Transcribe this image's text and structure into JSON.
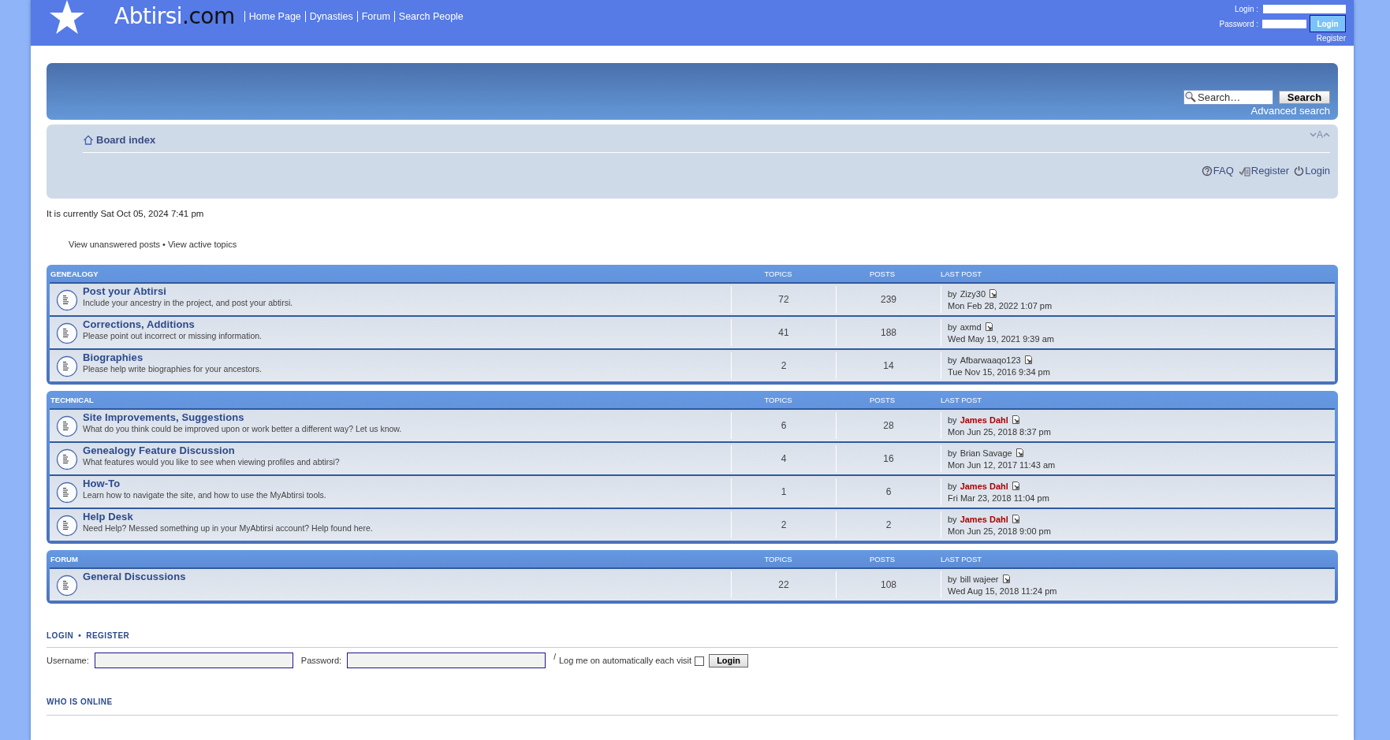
{
  "header": {
    "logo_main": "Abtirsi",
    "logo_suffix": ".com",
    "nav": [
      "Home Page",
      "Dynasties",
      "Forum",
      "Search People"
    ],
    "login_label": "Login :",
    "password_label": "Password :",
    "login_button": "Login",
    "register_link": "Register"
  },
  "headerbar": {
    "search": {
      "placeholder": "Search…"
    },
    "search_button": "Search",
    "advanced_search": "Advanced search"
  },
  "navbar": {
    "breadcrumb": "Board index",
    "font_size_label": "A",
    "links": [
      {
        "kind": "faq",
        "label": "FAQ"
      },
      {
        "kind": "register",
        "label": "Register"
      },
      {
        "kind": "login",
        "label": "Login"
      }
    ]
  },
  "current_time": "It is currently Sat Oct 05, 2024 7:41 pm",
  "quick_links": [
    "View unanswered posts",
    "View active topics"
  ],
  "quick_links_separator": "•",
  "forum_groups": [
    {
      "title": "GENEALOGY",
      "columns": [
        "TOPICS",
        "POSTS",
        "LAST POST"
      ],
      "forums": [
        {
          "name": "Post your Abtirsi",
          "description": "Include your ancestry in the project, and post your abtirsi.",
          "topics": "72",
          "posts": "239",
          "last_post": {
            "by": "by",
            "author": "Zizy30",
            "color": "#333333",
            "date": "Mon Feb 28, 2022 1:07 pm"
          }
        },
        {
          "name": "Corrections, Additions",
          "description": "Please point out incorrect or missing information.",
          "topics": "41",
          "posts": "188",
          "last_post": {
            "by": "by",
            "author": "axmd",
            "color": "#333333",
            "date": "Wed May 19, 2021 9:39 am"
          }
        },
        {
          "name": "Biographies",
          "description": "Please help write biographies for your ancestors.",
          "topics": "2",
          "posts": "14",
          "last_post": {
            "by": "by",
            "author": "Afbarwaaqo123",
            "color": "#333333",
            "date": "Tue Nov 15, 2016 9:34 pm"
          }
        }
      ]
    },
    {
      "title": "TECHNICAL",
      "columns": [
        "TOPICS",
        "POSTS",
        "LAST POST"
      ],
      "forums": [
        {
          "name": "Site Improvements, Suggestions",
          "description": "What do you think could be improved upon or work better a different way? Let us know.",
          "topics": "6",
          "posts": "28",
          "last_post": {
            "by": "by",
            "author": "James Dahl",
            "color": "#aa0000",
            "date": "Mon Jun 25, 2018 8:37 pm"
          }
        },
        {
          "name": "Genealogy Feature Discussion",
          "description": "What features would you like to see when viewing profiles and abtirsi?",
          "topics": "4",
          "posts": "16",
          "last_post": {
            "by": "by",
            "author": "Brian Savage",
            "color": "#333333",
            "date": "Mon Jun 12, 2017 11:43 am"
          }
        },
        {
          "name": "How-To",
          "description": "Learn how to navigate the site, and how to use the MyAbtirsi tools.",
          "topics": "1",
          "posts": "6",
          "last_post": {
            "by": "by",
            "author": "James Dahl",
            "color": "#aa0000",
            "date": "Fri Mar 23, 2018 11:04 pm"
          }
        },
        {
          "name": "Help Desk",
          "description": "Need Help? Messed something up in your MyAbtirsi account? Help found here.",
          "topics": "2",
          "posts": "2",
          "last_post": {
            "by": "by",
            "author": "James Dahl",
            "color": "#aa0000",
            "date": "Mon Jun 25, 2018 9:00 pm"
          }
        }
      ]
    },
    {
      "title": "FORUM",
      "columns": [
        "TOPICS",
        "POSTS",
        "LAST POST"
      ],
      "forums": [
        {
          "name": "General Discussions",
          "topics": "22",
          "posts": "108",
          "last_post": {
            "by": "by",
            "author": "bill wajeer",
            "color": "#333333",
            "date": "Wed Aug 15, 2018 11:24 pm"
          }
        }
      ]
    }
  ],
  "login_section": {
    "links": [
      "LOGIN",
      "REGISTER"
    ],
    "separator": "•",
    "username_label": "Username:",
    "password_label": "Password:",
    "slash": "/",
    "auto_login_label": "Log me on automatically each visit",
    "auto_login": {
      "checked": false
    },
    "button": "Login"
  },
  "who_is_online": {
    "title": "WHO IS ONLINE"
  }
}
